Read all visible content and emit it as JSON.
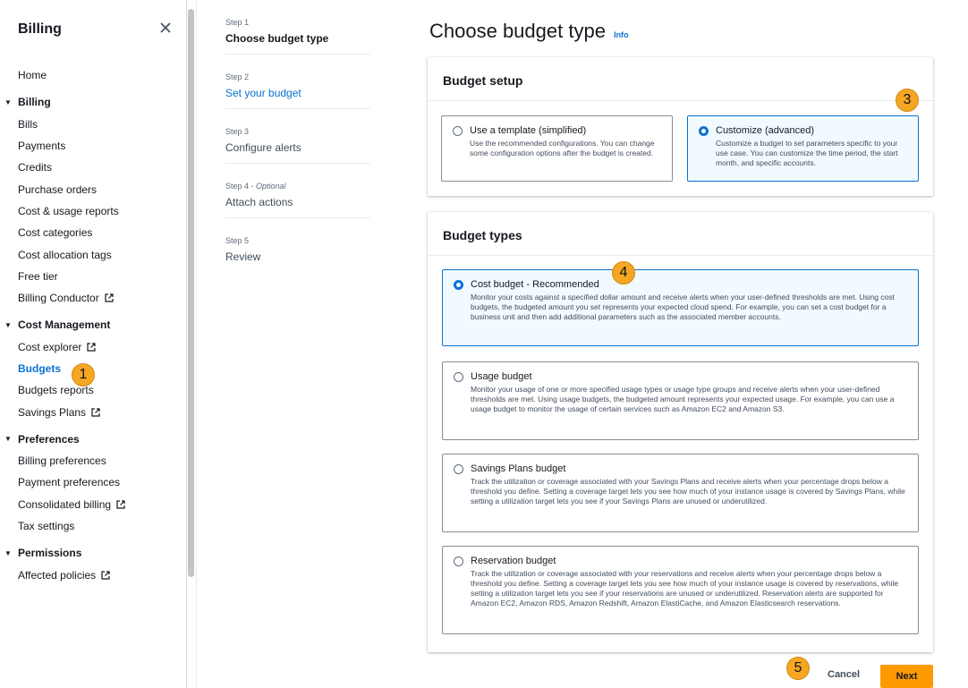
{
  "sidebar": {
    "title": "Billing",
    "home": "Home",
    "sections": {
      "billing": {
        "label": "Billing",
        "items": [
          "Bills",
          "Payments",
          "Credits",
          "Purchase orders",
          "Cost & usage reports",
          "Cost categories",
          "Cost allocation tags",
          "Free tier",
          "Billing Conductor"
        ]
      },
      "cost_management": {
        "label": "Cost Management",
        "items": [
          "Cost explorer",
          "Budgets",
          "Budgets reports",
          "Savings Plans"
        ]
      },
      "preferences": {
        "label": "Preferences",
        "items": [
          "Billing preferences",
          "Payment preferences",
          "Consolidated billing",
          "Tax settings"
        ]
      },
      "permissions": {
        "label": "Permissions",
        "items": [
          "Affected policies"
        ]
      }
    }
  },
  "steps": [
    {
      "num": "Step 1",
      "label": "Choose budget type"
    },
    {
      "num": "Step 2",
      "label": "Set your budget"
    },
    {
      "num": "Step 3",
      "label": "Configure alerts"
    },
    {
      "num": "Step 4",
      "optional": "Optional",
      "label": "Attach actions"
    },
    {
      "num": "Step 5",
      "label": "Review"
    }
  ],
  "page": {
    "title": "Choose budget type",
    "info": "Info"
  },
  "budget_setup": {
    "heading": "Budget setup",
    "options": [
      {
        "title": "Use a template (simplified)",
        "desc": "Use the recommended configurations. You can change some configuration options after the budget is created.",
        "selected": false
      },
      {
        "title": "Customize (advanced)",
        "desc": "Customize a budget to set parameters specific to your use case. You can customize the time period, the start month, and specific accounts.",
        "selected": true
      }
    ]
  },
  "budget_types": {
    "heading": "Budget types",
    "options": [
      {
        "title": "Cost budget - Recommended",
        "desc": "Monitor your costs against a specified dollar amount and receive alerts when your user-defined thresholds are met. Using cost budgets, the budgeted amount you set represents your expected cloud spend. For example, you can set a cost budget for a business unit and then add additional parameters such as the associated member accounts.",
        "selected": true
      },
      {
        "title": "Usage budget",
        "desc": "Monitor your usage of one or more specified usage types or usage type groups and receive alerts when your user-defined thresholds are met. Using usage budgets, the budgeted amount represents your expected usage. For example, you can use a usage budget to monitor the usage of certain services such as Amazon EC2 and Amazon S3.",
        "selected": false
      },
      {
        "title": "Savings Plans budget",
        "desc": "Track the utilization or coverage associated with your Savings Plans and receive alerts when your percentage drops below a threshold you define. Setting a coverage target lets you see how much of your instance usage is covered by Savings Plans, while setting a utilization target lets you see if your Savings Plans are unused or underutilized.",
        "selected": false
      },
      {
        "title": "Reservation budget",
        "desc": "Track the utilization or coverage associated with your reservations and receive alerts when your percentage drops below a threshold you define. Setting a coverage target lets you see how much of your instance usage is covered by reservations, while setting a utilization target lets you see if your reservations are unused or underutilized. Reservation alerts are supported for Amazon EC2, Amazon RDS, Amazon Redshift, Amazon ElastiCache, and Amazon Elasticsearch reservations.",
        "selected": false
      }
    ]
  },
  "footer": {
    "cancel": "Cancel",
    "next": "Next"
  },
  "badges": [
    "1",
    "3",
    "4",
    "5"
  ],
  "colors": {
    "accent": "#0972d3",
    "primary_button": "#ff9900",
    "badge": "#f5a623"
  }
}
